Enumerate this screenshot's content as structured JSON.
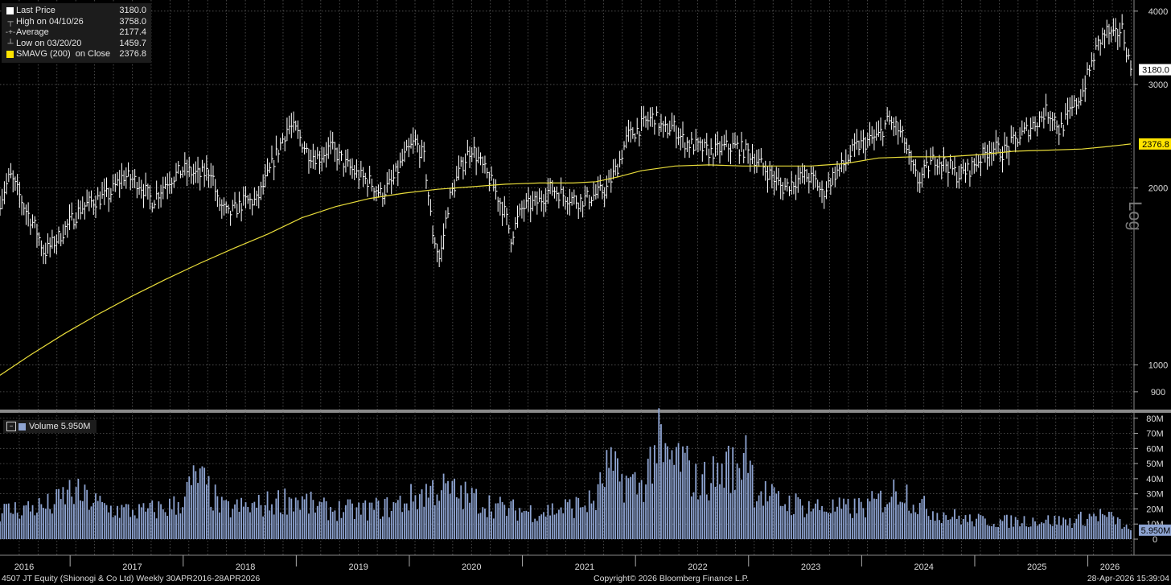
{
  "legend": {
    "rows": [
      {
        "icon": "square",
        "label": "Last Price",
        "value": "3180.0",
        "color": "#ffffff"
      },
      {
        "icon": "high-marker",
        "label": "High on 04/10/26",
        "value": "3758.0"
      },
      {
        "icon": "average-marker",
        "label": "Average",
        "value": "2177.4"
      },
      {
        "icon": "low-marker",
        "label": "Low on 03/20/20",
        "value": "1459.7"
      },
      {
        "icon": "square",
        "label": "SMAVG (200)  on Close",
        "value": "2376.8",
        "color": "#ffe400"
      }
    ]
  },
  "volume_legend": {
    "label": "Volume 5.950M",
    "color": "#8ea4d2"
  },
  "footer": {
    "left": "4507 JT Equity (Shionogi & Co Ltd) Weekly 30APR2016-28APR2026",
    "center": "Copyright© 2026 Bloomberg Finance L.P.",
    "right": "28-Apr-2026 15:39:04"
  },
  "price_scale_label": "Log",
  "colors": {
    "background": "#000000",
    "price": "#ffffff",
    "sma": "#e8dc3a",
    "volume": "#8ea4d2",
    "grid": "#5a5a5a",
    "last_tag": "#ffffff",
    "sma_tag": "#ffe400"
  },
  "chart_data": {
    "type": "line",
    "price_axis": {
      "scale": "log",
      "ticks": [
        900,
        1000,
        2000,
        3000,
        4000
      ],
      "tick_labels": [
        "900",
        "1000",
        "2000",
        "3000",
        "4000"
      ],
      "ylim": [
        850,
        4100
      ]
    },
    "volume_axis": {
      "ticks": [
        0,
        10,
        20,
        30,
        40,
        50,
        60,
        70,
        80
      ],
      "tick_labels": [
        "0",
        "10M",
        "20M",
        "30M",
        "40M",
        "50M",
        "60M",
        "70M",
        "80M"
      ],
      "unit": "M",
      "ylim": [
        0,
        82
      ]
    },
    "x_axis": {
      "labels": [
        "2016",
        "2017",
        "2018",
        "2019",
        "2020",
        "2021",
        "2022",
        "2023",
        "2024",
        "2025",
        "2026"
      ],
      "range": [
        2016.33,
        2026.33
      ]
    },
    "last_price": 3180.0,
    "last_volume": 5.95,
    "sma_last": 2376.8,
    "price_series": {
      "name": "Last Price",
      "points": [
        [
          2016.33,
          1900
        ],
        [
          2016.42,
          2100
        ],
        [
          2016.55,
          1850
        ],
        [
          2016.65,
          1700
        ],
        [
          2016.72,
          1550
        ],
        [
          2016.85,
          1650
        ],
        [
          2016.95,
          1750
        ],
        [
          2017.05,
          1850
        ],
        [
          2017.15,
          1900
        ],
        [
          2017.3,
          1950
        ],
        [
          2017.42,
          2100
        ],
        [
          2017.55,
          2050
        ],
        [
          2017.68,
          1900
        ],
        [
          2017.8,
          2050
        ],
        [
          2017.95,
          2150
        ],
        [
          2018.1,
          2100
        ],
        [
          2018.2,
          2150
        ],
        [
          2018.25,
          1900
        ],
        [
          2018.35,
          1800
        ],
        [
          2018.5,
          1900
        ],
        [
          2018.6,
          1900
        ],
        [
          2018.7,
          2100
        ],
        [
          2018.8,
          2350
        ],
        [
          2018.88,
          2550
        ],
        [
          2018.95,
          2500
        ],
        [
          2019.05,
          2300
        ],
        [
          2019.15,
          2250
        ],
        [
          2019.25,
          2350
        ],
        [
          2019.38,
          2200
        ],
        [
          2019.5,
          2100
        ],
        [
          2019.6,
          2050
        ],
        [
          2019.7,
          1950
        ],
        [
          2019.8,
          2050
        ],
        [
          2019.9,
          2250
        ],
        [
          2020.0,
          2400
        ],
        [
          2020.08,
          2250
        ],
        [
          2020.15,
          1700
        ],
        [
          2020.22,
          1500
        ],
        [
          2020.3,
          1900
        ],
        [
          2020.4,
          2150
        ],
        [
          2020.5,
          2350
        ],
        [
          2020.58,
          2200
        ],
        [
          2020.7,
          2000
        ],
        [
          2020.8,
          1800
        ],
        [
          2020.85,
          1650
        ],
        [
          2020.95,
          1850
        ],
        [
          2021.1,
          1900
        ],
        [
          2021.2,
          2000
        ],
        [
          2021.3,
          1950
        ],
        [
          2021.45,
          1900
        ],
        [
          2021.6,
          1950
        ],
        [
          2021.7,
          2000
        ],
        [
          2021.8,
          2200
        ],
        [
          2021.88,
          2450
        ],
        [
          2021.95,
          2500
        ],
        [
          2022.05,
          2600
        ],
        [
          2022.12,
          2650
        ],
        [
          2022.2,
          2500
        ],
        [
          2022.28,
          2550
        ],
        [
          2022.38,
          2400
        ],
        [
          2022.5,
          2350
        ],
        [
          2022.62,
          2300
        ],
        [
          2022.75,
          2350
        ],
        [
          2022.85,
          2350
        ],
        [
          2022.95,
          2300
        ],
        [
          2023.05,
          2200
        ],
        [
          2023.15,
          2100
        ],
        [
          2023.25,
          2000
        ],
        [
          2023.35,
          2050
        ],
        [
          2023.45,
          2100
        ],
        [
          2023.55,
          2050
        ],
        [
          2023.6,
          1950
        ],
        [
          2023.7,
          2100
        ],
        [
          2023.8,
          2200
        ],
        [
          2023.9,
          2350
        ],
        [
          2024.0,
          2400
        ],
        [
          2024.1,
          2450
        ],
        [
          2024.18,
          2600
        ],
        [
          2024.25,
          2550
        ],
        [
          2024.33,
          2400
        ],
        [
          2024.38,
          2200
        ],
        [
          2024.45,
          2050
        ],
        [
          2024.52,
          2150
        ],
        [
          2024.6,
          2250
        ],
        [
          2024.7,
          2200
        ],
        [
          2024.8,
          2100
        ],
        [
          2024.9,
          2150
        ],
        [
          2025.0,
          2250
        ],
        [
          2025.1,
          2350
        ],
        [
          2025.2,
          2300
        ],
        [
          2025.3,
          2400
        ],
        [
          2025.4,
          2500
        ],
        [
          2025.5,
          2600
        ],
        [
          2025.58,
          2700
        ],
        [
          2025.65,
          2650
        ],
        [
          2025.7,
          2500
        ],
        [
          2025.8,
          2700
        ],
        [
          2025.9,
          2900
        ],
        [
          2025.97,
          3200
        ],
        [
          2026.05,
          3550
        ],
        [
          2026.12,
          3700
        ],
        [
          2026.18,
          3600
        ],
        [
          2026.25,
          3750
        ],
        [
          2026.3,
          3400
        ],
        [
          2026.33,
          3180
        ]
      ]
    },
    "sma_series": {
      "name": "SMAVG (200)",
      "points": [
        [
          2016.33,
          960
        ],
        [
          2016.6,
          1040
        ],
        [
          2016.9,
          1130
        ],
        [
          2017.2,
          1220
        ],
        [
          2017.5,
          1310
        ],
        [
          2017.8,
          1400
        ],
        [
          2018.1,
          1490
        ],
        [
          2018.4,
          1580
        ],
        [
          2018.7,
          1670
        ],
        [
          2019.0,
          1780
        ],
        [
          2019.3,
          1860
        ],
        [
          2019.6,
          1920
        ],
        [
          2019.9,
          1960
        ],
        [
          2020.2,
          1990
        ],
        [
          2020.5,
          2010
        ],
        [
          2020.8,
          2030
        ],
        [
          2021.1,
          2040
        ],
        [
          2021.4,
          2040
        ],
        [
          2021.6,
          2050
        ],
        [
          2021.8,
          2090
        ],
        [
          2022.0,
          2140
        ],
        [
          2022.3,
          2180
        ],
        [
          2022.6,
          2190
        ],
        [
          2022.9,
          2180
        ],
        [
          2023.2,
          2180
        ],
        [
          2023.5,
          2180
        ],
        [
          2023.8,
          2200
        ],
        [
          2024.1,
          2250
        ],
        [
          2024.4,
          2260
        ],
        [
          2024.7,
          2260
        ],
        [
          2025.0,
          2280
        ],
        [
          2025.3,
          2310
        ],
        [
          2025.6,
          2320
        ],
        [
          2025.9,
          2330
        ],
        [
          2026.1,
          2350
        ],
        [
          2026.33,
          2376.8
        ]
      ]
    },
    "volume_series": {
      "name": "Volume",
      "points": [
        [
          2016.5,
          22
        ],
        [
          2016.8,
          25
        ],
        [
          2016.95,
          35
        ],
        [
          2017.3,
          22
        ],
        [
          2017.6,
          20
        ],
        [
          2017.9,
          25
        ],
        [
          2018.08,
          46
        ],
        [
          2018.3,
          22
        ],
        [
          2018.6,
          24
        ],
        [
          2018.9,
          30
        ],
        [
          2019.2,
          22
        ],
        [
          2019.5,
          21
        ],
        [
          2019.8,
          24
        ],
        [
          2020.2,
          38
        ],
        [
          2020.5,
          30
        ],
        [
          2020.8,
          22
        ],
        [
          2021.1,
          20
        ],
        [
          2021.4,
          24
        ],
        [
          2021.6,
          28
        ],
        [
          2021.7,
          53
        ],
        [
          2021.8,
          45
        ],
        [
          2022.0,
          38
        ],
        [
          2022.15,
          72
        ],
        [
          2022.2,
          56
        ],
        [
          2022.35,
          59
        ],
        [
          2022.5,
          40
        ],
        [
          2022.6,
          45
        ],
        [
          2022.7,
          48
        ],
        [
          2022.78,
          56
        ],
        [
          2022.85,
          44
        ],
        [
          2022.93,
          77
        ],
        [
          2023.0,
          38
        ],
        [
          2023.2,
          28
        ],
        [
          2023.5,
          24
        ],
        [
          2023.8,
          22
        ],
        [
          2024.0,
          24
        ],
        [
          2024.15,
          30
        ],
        [
          2024.3,
          38
        ],
        [
          2024.45,
          25
        ],
        [
          2024.6,
          20
        ],
        [
          2024.9,
          14
        ],
        [
          2025.2,
          13
        ],
        [
          2025.5,
          14
        ],
        [
          2025.8,
          13
        ],
        [
          2026.05,
          18
        ],
        [
          2026.2,
          14
        ],
        [
          2026.33,
          5.95
        ]
      ]
    }
  }
}
